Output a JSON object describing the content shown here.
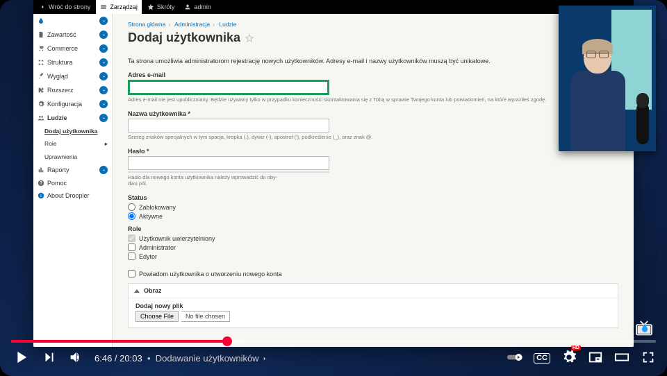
{
  "toolbar": {
    "back": "Wróć do strony",
    "manage": "Zarządzaj",
    "shortcuts": "Skróty",
    "user": "admin"
  },
  "sidebar": {
    "items": [
      {
        "label": "Zawartość"
      },
      {
        "label": "Commerce"
      },
      {
        "label": "Struktura"
      },
      {
        "label": "Wygląd"
      },
      {
        "label": "Rozszerz"
      },
      {
        "label": "Konfiguracja"
      },
      {
        "label": "Ludzie"
      },
      {
        "label": "Raporty"
      },
      {
        "label": "Pomoc"
      },
      {
        "label": "About Droopler"
      }
    ],
    "subs": {
      "add_user": "Dodaj użytkownika",
      "roles": "Role",
      "perms": "Uprawnienia"
    }
  },
  "crumbs": {
    "home": "Strona główna",
    "admin": "Administracja",
    "people": "Ludzie"
  },
  "page": {
    "title": "Dodaj użytkownika",
    "intro": "Ta strona umożliwia administratorom rejestrację nowych użytkowników. Adresy e-mail i nazwy użytkowników muszą być unikatowe."
  },
  "form": {
    "email_label": "Adres e-mail",
    "email_hint": "Adres e-mail nie jest upubliczniany. Będzie używany tylko w przypadku konieczności skontaktowania się z Tobą w sprawie Twojego konta lub powiadomień, na które wyraziłeś zgodę.",
    "username_label": "Nazwa użytkownika",
    "username_hint": "Szereg znaków specjalnych w tym spacja, kropka (.), dywiz (-), apostrof ('), podkreślenie (_), oraz znak @.",
    "password_label": "Hasło",
    "password_hint": "Hasło dla nowego konta użytkownika należy wprowadzić do oby-\ndwu pól.",
    "status_label": "Status",
    "status_blocked": "Zablokowany",
    "status_active": "Aktywne",
    "roles_label": "Role",
    "role_auth": "Użytkownik uwierzytelniony",
    "role_admin": "Administrator",
    "role_editor": "Edytor",
    "notify": "Powiadom użytkownika o utworzeniu nowego konta",
    "image_section": "Obraz",
    "add_file": "Dodaj nowy plik",
    "choose_file": "Choose File",
    "no_file": "No file chosen"
  },
  "player": {
    "current": "6:46",
    "total": "20:03",
    "chapter": "Dodawanie użytkowników",
    "hd": "HD",
    "cc": "CC"
  }
}
